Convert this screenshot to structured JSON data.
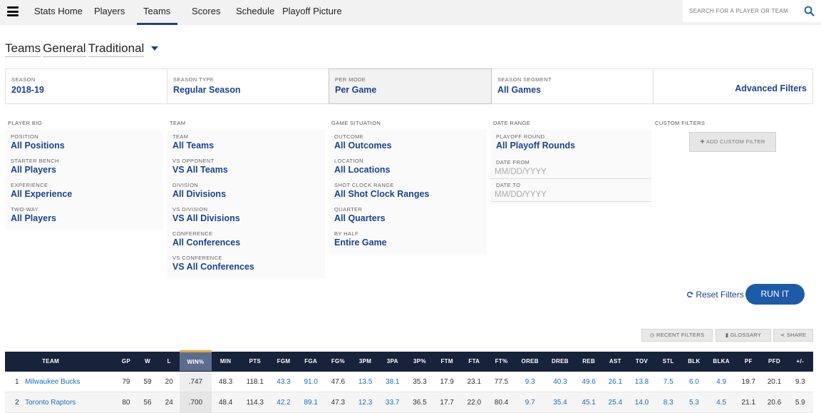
{
  "nav": {
    "items": [
      "Stats Home",
      "Players",
      "Teams",
      "Scores",
      "Schedule",
      "Playoff Picture"
    ],
    "active": "Teams",
    "search_placeholder": "SEARCH FOR A PLAYER OR TEAM"
  },
  "title": {
    "words": [
      "Teams",
      "General",
      "Traditional"
    ]
  },
  "primary_filters": [
    {
      "label": "SEASON",
      "value": "2018-19"
    },
    {
      "label": "SEASON TYPE",
      "value": "Regular Season"
    },
    {
      "label": "PER MODE",
      "value": "Per Game"
    },
    {
      "label": "SEASON SEGMENT",
      "value": "All Games"
    }
  ],
  "advanced_filters_label": "Advanced Filters",
  "filter_columns": {
    "player_bio": {
      "heading": "PLAYER BIO",
      "items": [
        {
          "label": "POSITION",
          "value": "All Positions"
        },
        {
          "label": "STARTER BENCH",
          "value": "All Players"
        },
        {
          "label": "EXPERIENCE",
          "value": "All Experience"
        },
        {
          "label": "TWO-WAY",
          "value": "All Players"
        }
      ]
    },
    "team": {
      "heading": "TEAM",
      "items": [
        {
          "label": "TEAM",
          "value": "All Teams"
        },
        {
          "label": "VS OPPONENT",
          "value": "VS All Teams"
        },
        {
          "label": "DIVISION",
          "value": "All Divisions"
        },
        {
          "label": "VS DIVISION",
          "value": "VS All Divisions"
        },
        {
          "label": "CONFERENCE",
          "value": "All Conferences"
        },
        {
          "label": "VS CONFERENCE",
          "value": "VS All Conferences"
        }
      ]
    },
    "game_situation": {
      "heading": "GAME SITUATION",
      "items": [
        {
          "label": "OUTCOME",
          "value": "All Outcomes"
        },
        {
          "label": "LOCATION",
          "value": "All Locations"
        },
        {
          "label": "SHOT CLOCK RANGE",
          "value": "All Shot Clock Ranges"
        },
        {
          "label": "QUARTER",
          "value": "All Quarters"
        },
        {
          "label": "BY HALF",
          "value": "Entire Game"
        }
      ]
    },
    "date_range": {
      "heading": "DATE RANGE",
      "playoff_round": {
        "label": "PLAYOFF ROUND",
        "value": "All Playoff Rounds"
      },
      "date_from": {
        "label": "DATE FROM",
        "placeholder": "MM/DD/YYYY"
      },
      "date_to": {
        "label": "DATE TO",
        "placeholder": "MM/DD/YYYY"
      }
    },
    "custom": {
      "heading": "CUSTOM FILTERS",
      "add_label": "ADD CUSTOM FILTER"
    }
  },
  "actions": {
    "reset_label": "Reset Filters",
    "run_label": "RUN IT",
    "recent_filters": "RECENT FILTERS",
    "glossary": "GLOSSARY",
    "share": "SHARE"
  },
  "table": {
    "columns": [
      "",
      "TEAM",
      "GP",
      "W",
      "L",
      "WIN%",
      "MIN",
      "PTS",
      "FGM",
      "FGA",
      "FG%",
      "3PM",
      "3PA",
      "3P%",
      "FTM",
      "FTA",
      "FT%",
      "OREB",
      "DREB",
      "REB",
      "AST",
      "TOV",
      "STL",
      "BLK",
      "BLKA",
      "PF",
      "PFD",
      "+/-"
    ],
    "sorted_column": "WIN%",
    "rows": [
      [
        "1",
        "Milwaukee Bucks",
        "79",
        "59",
        "20",
        ".747",
        "48.3",
        "118.1",
        "43.3",
        "91.0",
        "47.6",
        "13.5",
        "38.1",
        "35.3",
        "17.9",
        "23.1",
        "77.5",
        "9.3",
        "40.3",
        "49.6",
        "26.1",
        "13.8",
        "7.5",
        "6.0",
        "4.9",
        "19.7",
        "20.1",
        "9.3"
      ],
      [
        "2",
        "Toronto Raptors",
        "80",
        "56",
        "24",
        ".700",
        "48.4",
        "114.3",
        "42.2",
        "89.1",
        "47.3",
        "12.3",
        "33.7",
        "36.5",
        "17.7",
        "22.0",
        "80.4",
        "9.7",
        "35.4",
        "45.1",
        "25.4",
        "14.0",
        "8.3",
        "5.3",
        "4.5",
        "21.1",
        "20.6",
        "5.9"
      ]
    ]
  },
  "colors": {
    "brand_blue": "#1d428a",
    "table_header": "#17223b",
    "sorted_accent": "#e6a63d",
    "run_button": "#1d5ba8"
  }
}
